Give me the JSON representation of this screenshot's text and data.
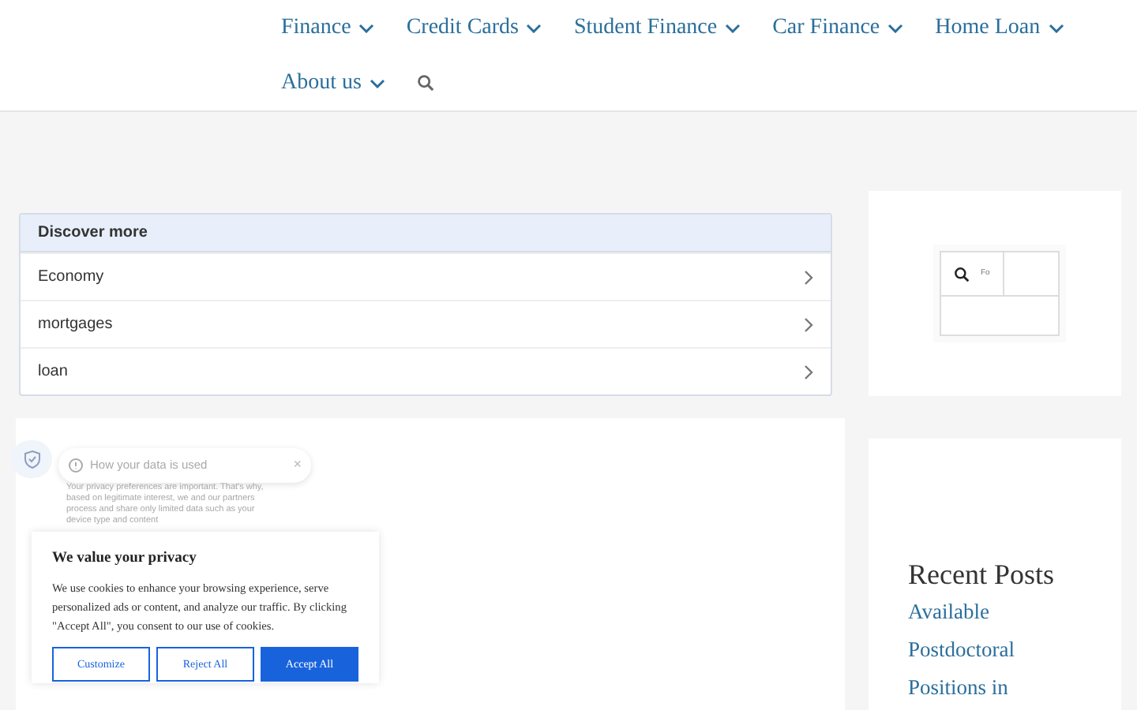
{
  "nav": {
    "items": [
      {
        "label": "Finance"
      },
      {
        "label": "Credit Cards"
      },
      {
        "label": "Student Finance"
      },
      {
        "label": "Car Finance"
      },
      {
        "label": "Home Loan"
      },
      {
        "label": "About us"
      }
    ]
  },
  "discover": {
    "title": "Discover more",
    "items": [
      "Economy",
      "mortgages",
      "loan"
    ]
  },
  "search_widget": {
    "placeholder": "Fo"
  },
  "privacy_tooltip": {
    "title": "How your data is used",
    "close": "×",
    "text": "Your privacy preferences are important. That's why, based on legitimate interest, we and our partners process and share only limited data such as your device type and content"
  },
  "cookie_banner": {
    "title": "We value your privacy",
    "text": "We use cookies to enhance your browsing experience, serve personalized ads or content, and analyze our traffic. By clicking \"Accept All\", you consent to our use of cookies.",
    "buttons": [
      {
        "label": "Customize",
        "kind": "outline"
      },
      {
        "label": "Reject All",
        "kind": "outline"
      },
      {
        "label": "Accept All",
        "kind": "primary"
      }
    ]
  },
  "recent_posts": {
    "title": "Recent Posts",
    "items": [
      "Available Postdoctoral Positions in"
    ]
  }
}
